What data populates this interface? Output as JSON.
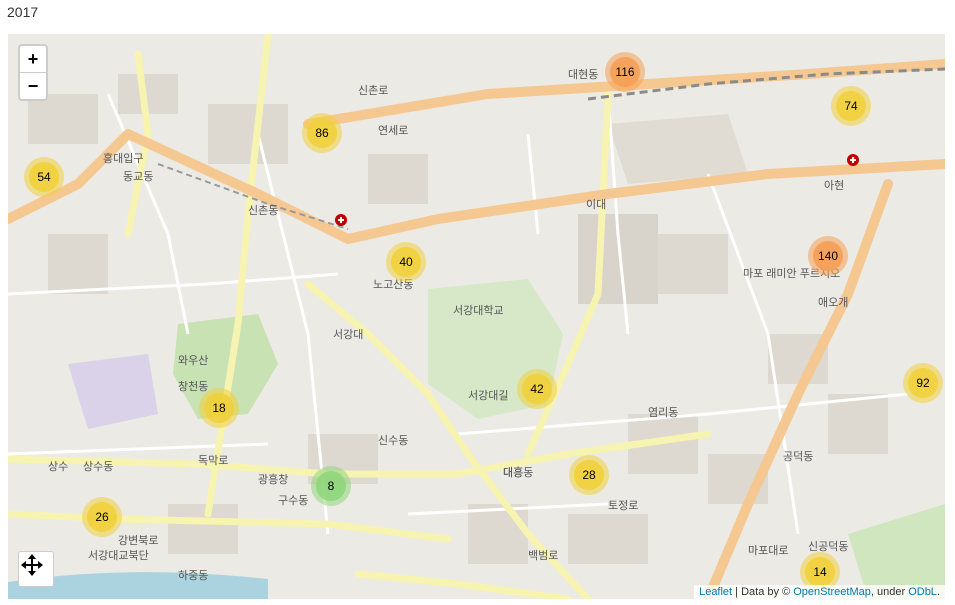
{
  "page": {
    "title": "2017"
  },
  "map": {
    "zoom_in_label": "+",
    "zoom_out_label": "−",
    "move_control_icon": "move-arrows-icon",
    "attribution": {
      "leaflet": "Leaflet",
      "separator": " | Data by © ",
      "osm": "OpenStreetMap",
      "under": ", under ",
      "odbl": "ODbL",
      "end": "."
    },
    "cluster_colors": {
      "small": "#8fd67b",
      "medium": "#f0d03c",
      "large": "#f5a055"
    },
    "clusters": [
      {
        "count": 116,
        "size": "large"
      },
      {
        "count": 74,
        "size": "medium"
      },
      {
        "count": 86,
        "size": "medium"
      },
      {
        "count": 54,
        "size": "medium"
      },
      {
        "count": 140,
        "size": "large"
      },
      {
        "count": 40,
        "size": "medium"
      },
      {
        "count": 42,
        "size": "medium"
      },
      {
        "count": 92,
        "size": "medium"
      },
      {
        "count": 18,
        "size": "medium"
      },
      {
        "count": 28,
        "size": "medium"
      },
      {
        "count": 8,
        "size": "small"
      },
      {
        "count": 26,
        "size": "medium"
      },
      {
        "count": 14,
        "size": "medium"
      }
    ],
    "hospital_markers": [
      {
        "name": "hospital"
      },
      {
        "name": "hospital"
      }
    ],
    "places": [
      "대현동",
      "신촌로",
      "연세로",
      "신촌동",
      "홍대입구",
      "동교동",
      "이대",
      "아현",
      "노고산동",
      "서강대학교",
      "서강대",
      "창천동",
      "염리동",
      "공덕동",
      "애오개",
      "대흥동",
      "신수동",
      "광흥창",
      "구수동",
      "상수동",
      "상수",
      "대흥",
      "신공덕동",
      "마포대로",
      "독막로",
      "토정로",
      "백범로",
      "서강대길",
      "마포 래미안 푸르지오",
      "와우산",
      "하중동",
      "강변북로",
      "서강대교북단"
    ]
  }
}
